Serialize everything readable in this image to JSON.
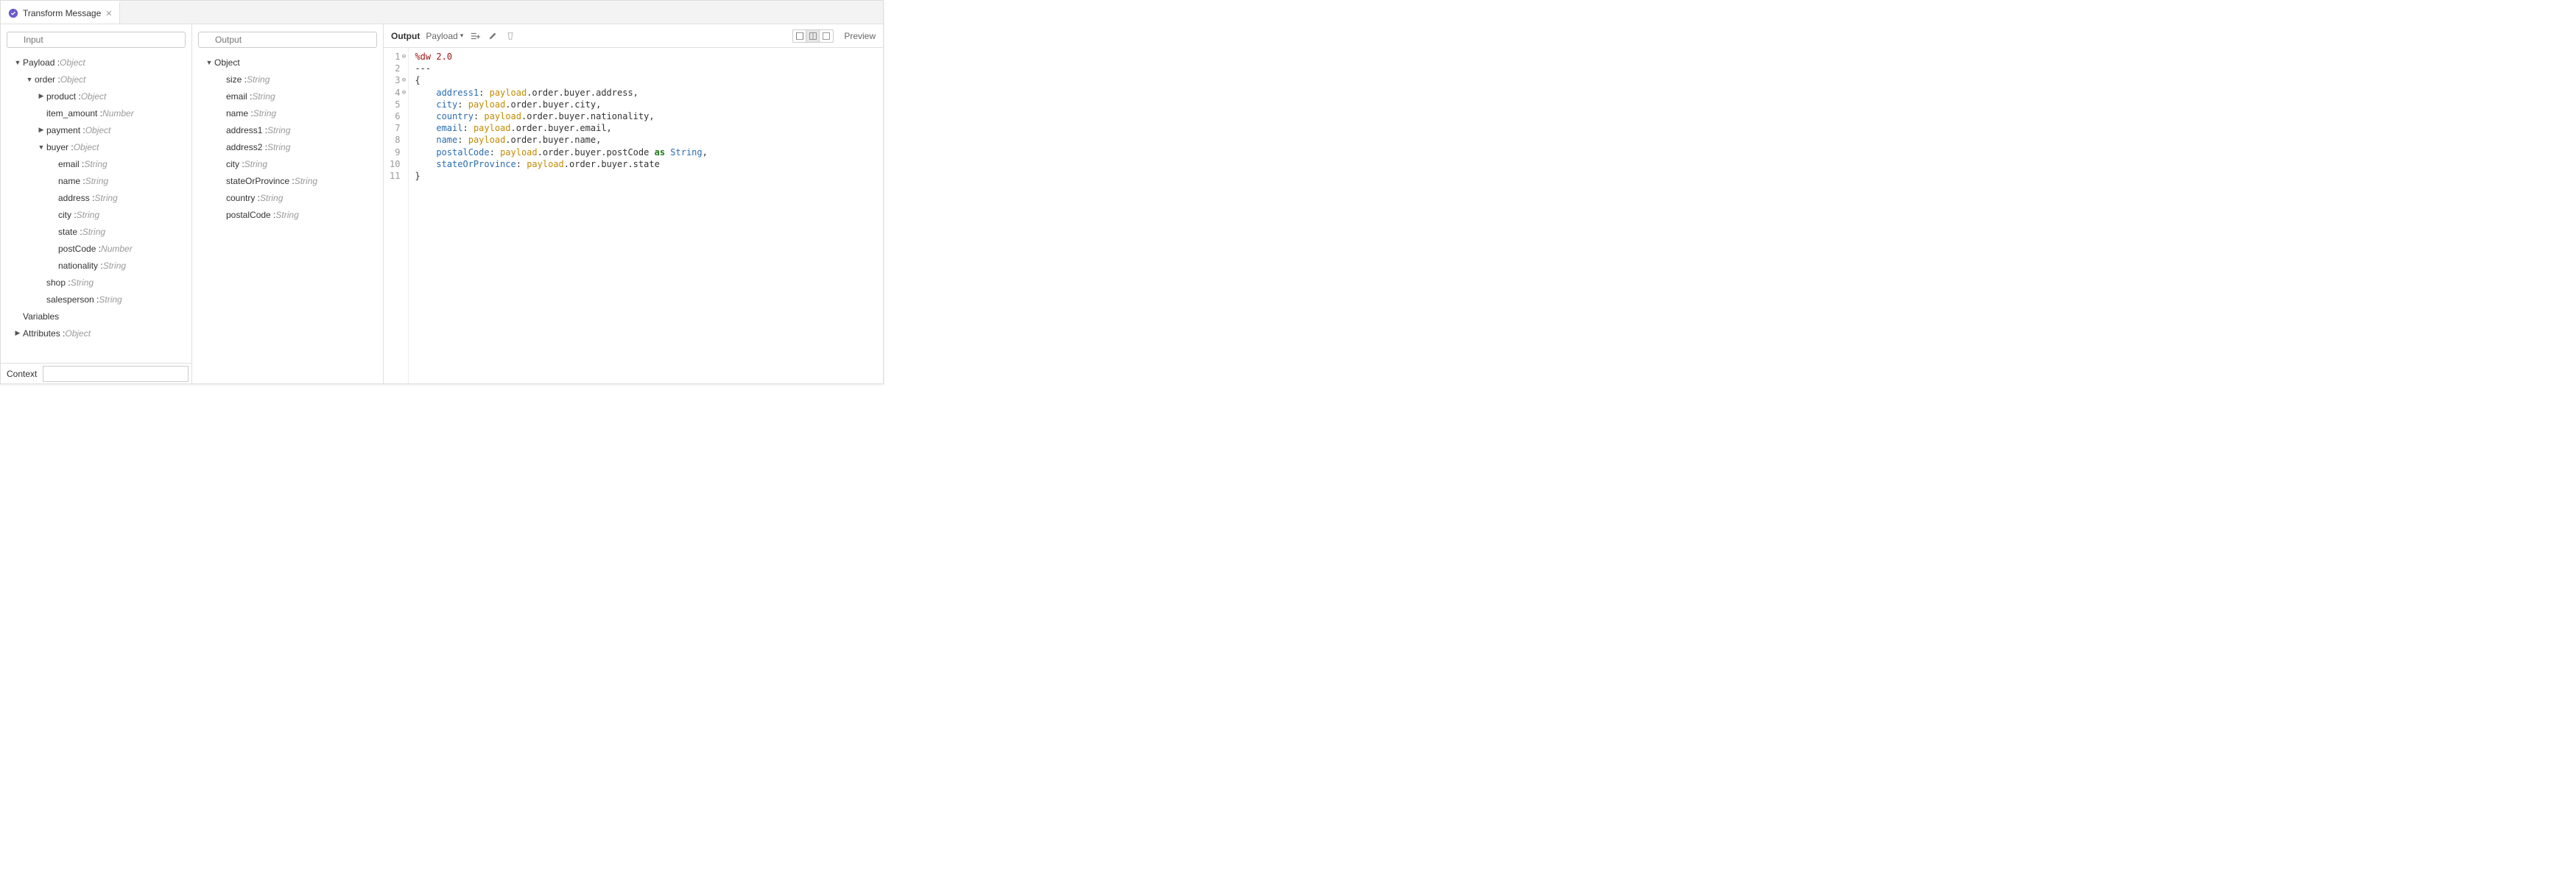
{
  "tab": {
    "title": "Transform Message"
  },
  "search": {
    "input_placeholder": "Input",
    "output_placeholder": "Output"
  },
  "input_tree": [
    {
      "indent": 0,
      "arrow": "▼",
      "name": "Payload : ",
      "type": "Object"
    },
    {
      "indent": 1,
      "arrow": "▼",
      "name": "order : ",
      "type": "Object"
    },
    {
      "indent": 2,
      "arrow": "▶",
      "name": "product : ",
      "type": "Object"
    },
    {
      "indent": 2,
      "arrow": "",
      "name": "item_amount : ",
      "type": "Number"
    },
    {
      "indent": 2,
      "arrow": "▶",
      "name": "payment : ",
      "type": "Object"
    },
    {
      "indent": 2,
      "arrow": "▼",
      "name": "buyer : ",
      "type": "Object"
    },
    {
      "indent": 3,
      "arrow": "",
      "name": "email : ",
      "type": "String"
    },
    {
      "indent": 3,
      "arrow": "",
      "name": "name : ",
      "type": "String"
    },
    {
      "indent": 3,
      "arrow": "",
      "name": "address : ",
      "type": "String"
    },
    {
      "indent": 3,
      "arrow": "",
      "name": "city : ",
      "type": "String"
    },
    {
      "indent": 3,
      "arrow": "",
      "name": "state : ",
      "type": "String"
    },
    {
      "indent": 3,
      "arrow": "",
      "name": "postCode : ",
      "type": "Number"
    },
    {
      "indent": 3,
      "arrow": "",
      "name": "nationality : ",
      "type": "String"
    },
    {
      "indent": 2,
      "arrow": "",
      "name": "shop : ",
      "type": "String"
    },
    {
      "indent": 2,
      "arrow": "",
      "name": "salesperson : ",
      "type": "String"
    },
    {
      "indent": 0,
      "arrow": "",
      "name": "Variables",
      "type": ""
    },
    {
      "indent": 0,
      "arrow": "▶",
      "name": "Attributes : ",
      "type": "Object"
    }
  ],
  "output_tree": [
    {
      "indent": 0,
      "arrow": "▼",
      "name": "Object",
      "type": ""
    },
    {
      "indent": 1,
      "arrow": "",
      "name": "size : ",
      "type": "String"
    },
    {
      "indent": 1,
      "arrow": "",
      "name": "email : ",
      "type": "String"
    },
    {
      "indent": 1,
      "arrow": "",
      "name": "name : ",
      "type": "String"
    },
    {
      "indent": 1,
      "arrow": "",
      "name": "address1 : ",
      "type": "String"
    },
    {
      "indent": 1,
      "arrow": "",
      "name": "address2 : ",
      "type": "String"
    },
    {
      "indent": 1,
      "arrow": "",
      "name": "city : ",
      "type": "String"
    },
    {
      "indent": 1,
      "arrow": "",
      "name": "stateOrProvince : ",
      "type": "String"
    },
    {
      "indent": 1,
      "arrow": "",
      "name": "country : ",
      "type": "String"
    },
    {
      "indent": 1,
      "arrow": "",
      "name": "postalCode : ",
      "type": "String"
    }
  ],
  "context": {
    "label": "Context"
  },
  "editor_toolbar": {
    "output_label": "Output",
    "payload_label": "Payload",
    "preview_label": "Preview"
  },
  "code": {
    "lines": [
      {
        "n": 1,
        "fold": "⊖",
        "tokens": [
          [
            "kw",
            "%dw 2.0"
          ]
        ]
      },
      {
        "n": 2,
        "fold": "",
        "tokens": [
          [
            "punc",
            "---"
          ]
        ]
      },
      {
        "n": 3,
        "fold": "⊖",
        "tokens": [
          [
            "punc",
            "{"
          ]
        ]
      },
      {
        "n": 4,
        "fold": "⊖",
        "tokens": [
          [
            "pad",
            "    "
          ],
          [
            "key",
            "address1"
          ],
          [
            "punc",
            ": "
          ],
          [
            "pay",
            "payload"
          ],
          [
            "punc",
            ".order.buyer.address,"
          ]
        ]
      },
      {
        "n": 5,
        "fold": "",
        "tokens": [
          [
            "pad",
            "    "
          ],
          [
            "key",
            "city"
          ],
          [
            "punc",
            ": "
          ],
          [
            "pay",
            "payload"
          ],
          [
            "punc",
            ".order.buyer.city,"
          ]
        ]
      },
      {
        "n": 6,
        "fold": "",
        "tokens": [
          [
            "pad",
            "    "
          ],
          [
            "key",
            "country"
          ],
          [
            "punc",
            ": "
          ],
          [
            "pay",
            "payload"
          ],
          [
            "punc",
            ".order.buyer.nationality,"
          ]
        ]
      },
      {
        "n": 7,
        "fold": "",
        "tokens": [
          [
            "pad",
            "    "
          ],
          [
            "key",
            "email"
          ],
          [
            "punc",
            ": "
          ],
          [
            "pay",
            "payload"
          ],
          [
            "punc",
            ".order.buyer.email,"
          ]
        ]
      },
      {
        "n": 8,
        "fold": "",
        "tokens": [
          [
            "pad",
            "    "
          ],
          [
            "key",
            "name"
          ],
          [
            "punc",
            ": "
          ],
          [
            "pay",
            "payload"
          ],
          [
            "punc",
            ".order.buyer.name,"
          ]
        ]
      },
      {
        "n": 9,
        "fold": "",
        "tokens": [
          [
            "pad",
            "    "
          ],
          [
            "key",
            "postalCode"
          ],
          [
            "punc",
            ": "
          ],
          [
            "pay",
            "payload"
          ],
          [
            "punc",
            ".order.buyer.postCode "
          ],
          [
            "as",
            "as"
          ],
          [
            "punc",
            " "
          ],
          [
            "type",
            "String"
          ],
          [
            "punc",
            ","
          ]
        ]
      },
      {
        "n": 10,
        "fold": "",
        "tokens": [
          [
            "pad",
            "    "
          ],
          [
            "key",
            "stateOrProvince"
          ],
          [
            "punc",
            ": "
          ],
          [
            "pay",
            "payload"
          ],
          [
            "punc",
            ".order.buyer.state"
          ]
        ]
      },
      {
        "n": 11,
        "fold": "",
        "tokens": [
          [
            "punc",
            "}"
          ]
        ]
      }
    ]
  }
}
